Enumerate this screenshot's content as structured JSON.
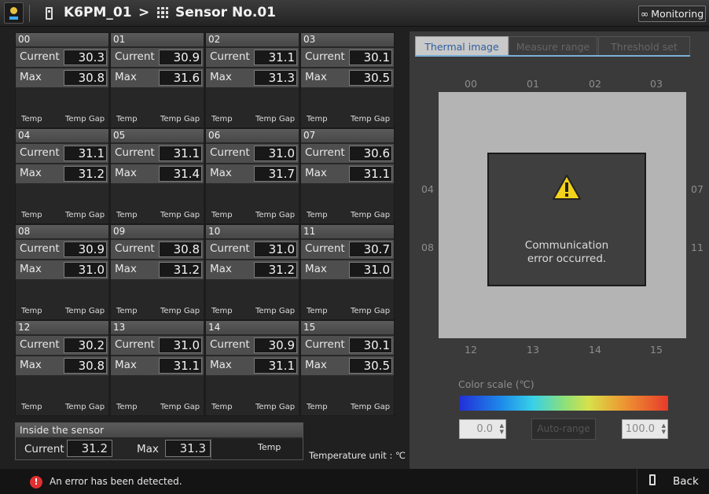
{
  "header": {
    "device": "K6PM_01",
    "separator": ">",
    "sensor": "Sensor No.01",
    "monitoring_label": "Monitoring"
  },
  "labels": {
    "current": "Current",
    "max": "Max",
    "temp": "Temp",
    "temp_gap": "Temp Gap"
  },
  "cells": [
    {
      "id": "00",
      "current": "30.3",
      "max": "30.8"
    },
    {
      "id": "01",
      "current": "30.9",
      "max": "31.6"
    },
    {
      "id": "02",
      "current": "31.1",
      "max": "31.3"
    },
    {
      "id": "03",
      "current": "30.1",
      "max": "30.5"
    },
    {
      "id": "04",
      "current": "31.1",
      "max": "31.2"
    },
    {
      "id": "05",
      "current": "31.1",
      "max": "31.4"
    },
    {
      "id": "06",
      "current": "31.0",
      "max": "31.7"
    },
    {
      "id": "07",
      "current": "30.6",
      "max": "31.1"
    },
    {
      "id": "08",
      "current": "30.9",
      "max": "31.0"
    },
    {
      "id": "09",
      "current": "30.8",
      "max": "31.2"
    },
    {
      "id": "10",
      "current": "31.0",
      "max": "31.2"
    },
    {
      "id": "11",
      "current": "30.7",
      "max": "31.0"
    },
    {
      "id": "12",
      "current": "30.2",
      "max": "30.8"
    },
    {
      "id": "13",
      "current": "31.0",
      "max": "31.1"
    },
    {
      "id": "14",
      "current": "30.9",
      "max": "31.1"
    },
    {
      "id": "15",
      "current": "30.1",
      "max": "30.5"
    }
  ],
  "inside_sensor": {
    "title": "Inside the sensor",
    "current_label": "Current",
    "current": "31.2",
    "max_label": "Max",
    "max": "31.3",
    "temp_label": "Temp"
  },
  "temperature_unit": "Temperature unit : ℃",
  "tabs": {
    "thermal": "Thermal image",
    "measure": "Measure range",
    "threshold": "Threshold set"
  },
  "thermal": {
    "top_labels": [
      "00",
      "01",
      "02",
      "03"
    ],
    "bottom_labels": [
      "12",
      "13",
      "14",
      "15"
    ],
    "left_labels": [
      "04",
      "08"
    ],
    "right_labels": [
      "07",
      "11"
    ],
    "error_line1": "Communication",
    "error_line2": "error occurred."
  },
  "color_scale": {
    "label": "Color scale (℃)",
    "min": "0.0",
    "max": "100.0",
    "auto_range": "Auto-range"
  },
  "status": {
    "message": "An error has been detected.",
    "back_label": "Back",
    "error_color": "#e03030"
  }
}
